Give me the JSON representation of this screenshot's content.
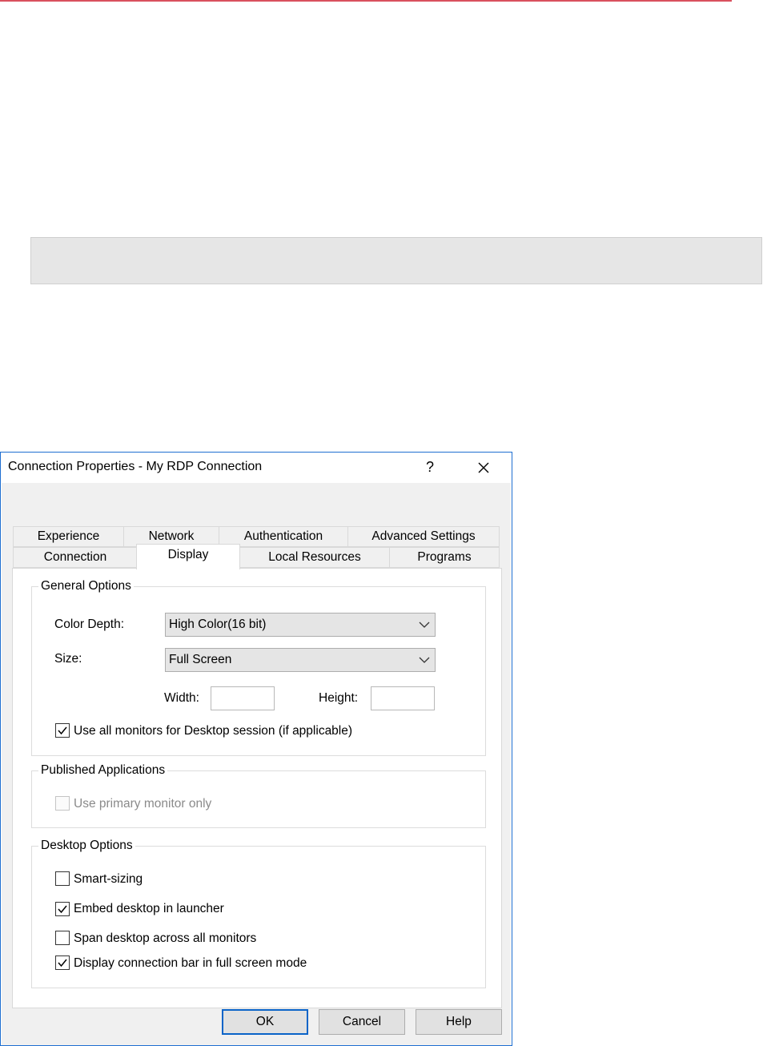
{
  "dialog": {
    "title": "Connection Properties - My RDP Connection",
    "help_label": "?",
    "tabs_row_top": [
      "Experience",
      "Network",
      "Authentication",
      "Advanced Settings"
    ],
    "tabs_row_bottom": [
      "Connection",
      "Display",
      "Local Resources",
      "Programs"
    ],
    "active_tab": "Display"
  },
  "general": {
    "legend": "General Options",
    "color_depth_label": "Color Depth:",
    "color_depth_value": "High Color(16 bit)",
    "size_label": "Size:",
    "size_value": "Full Screen",
    "width_label": "Width:",
    "height_label": "Height:",
    "width_value": "",
    "height_value": "",
    "all_monitors_label": "Use all monitors for Desktop session (if applicable)",
    "all_monitors_checked": true
  },
  "published": {
    "legend": "Published Applications",
    "primary_monitor_label": "Use primary monitor only",
    "primary_monitor_checked": false,
    "primary_monitor_enabled": false
  },
  "desktop": {
    "legend": "Desktop Options",
    "options": [
      {
        "label": "Smart-sizing",
        "checked": false
      },
      {
        "label": "Embed desktop in launcher",
        "checked": true
      },
      {
        "label": "Span desktop across all monitors",
        "checked": false
      },
      {
        "label": "Display connection bar in full screen mode",
        "checked": true
      }
    ]
  },
  "buttons": {
    "ok": "OK",
    "cancel": "Cancel",
    "help": "Help"
  },
  "colors": {
    "page_rule": "#d9505e",
    "dialog_border": "#1f6fd1",
    "default_button_border": "#0a64c8"
  }
}
